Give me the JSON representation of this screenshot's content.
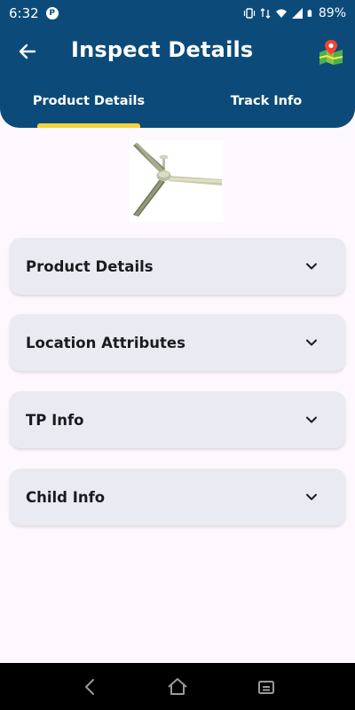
{
  "status_bar": {
    "time": "6:32",
    "app_icon_glyph": "P",
    "battery": "89%"
  },
  "header": {
    "title": "Inspect Details",
    "back_icon": "arrow-left-icon",
    "map_icon": "map-pin-icon"
  },
  "tabs": [
    {
      "label": "Product Details",
      "active": true
    },
    {
      "label": "Track Info",
      "active": false
    }
  ],
  "sections": [
    {
      "title": "Product Details"
    },
    {
      "title": "Location Attributes"
    },
    {
      "title": "TP Info"
    },
    {
      "title": "Child Info"
    }
  ],
  "colors": {
    "header_bg": "#0c4b79",
    "tab_indicator": "#f5d33b",
    "card_bg": "#eaeaf2",
    "page_bg": "#fdf8fd"
  }
}
